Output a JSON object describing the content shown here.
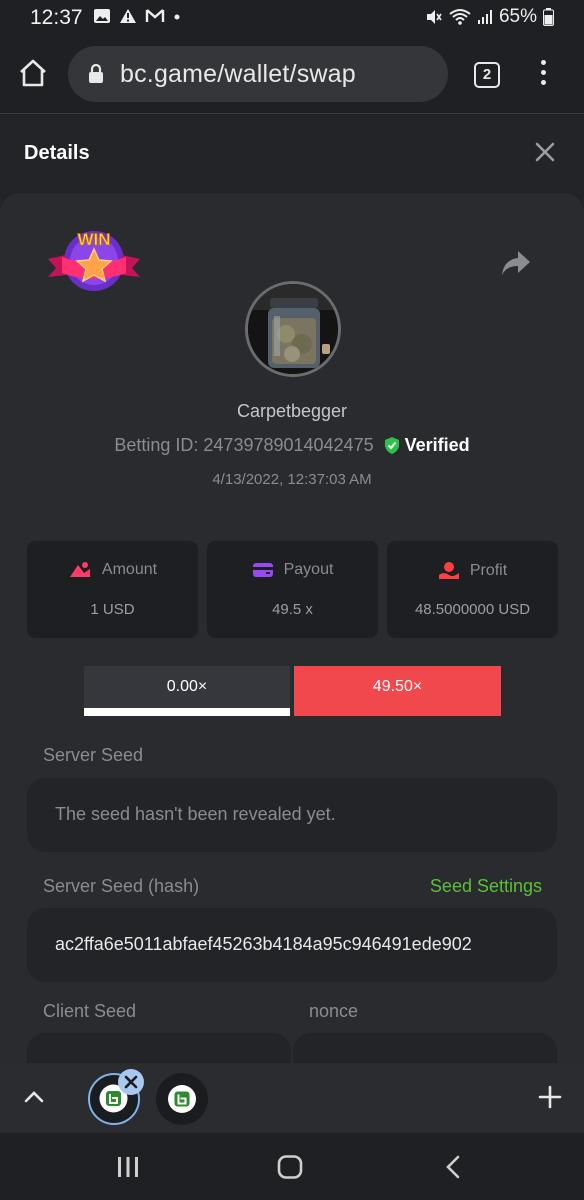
{
  "status_bar": {
    "time": "12:37",
    "battery": "65%",
    "left_icons": [
      "image-icon",
      "warning-icon",
      "gmail-icon",
      "dot-icon"
    ],
    "right_icons": [
      "mute-icon",
      "wifi-icon",
      "signal-icon",
      "battery-icon"
    ]
  },
  "browser": {
    "url": "bc.game/wallet/swap",
    "tab_count": "2"
  },
  "panel": {
    "title": "Details"
  },
  "bet": {
    "badge": "WIN",
    "username": "Carpetbegger",
    "betting_id_label": "Betting ID:",
    "betting_id": "24739789014042475",
    "verified": "Verified",
    "datetime": "4/13/2022, 12:37:03 AM"
  },
  "stats": [
    {
      "label": "Amount",
      "value": "1 USD",
      "icon": "amount-icon"
    },
    {
      "label": "Payout",
      "value": "49.5 x",
      "icon": "wallet-icon"
    },
    {
      "label": "Profit",
      "value": "48.5000000 USD",
      "icon": "profit-icon"
    }
  ],
  "result": {
    "left": "0.00×",
    "right": "49.50×",
    "progress_percent": 100
  },
  "fields": {
    "server_seed_label": "Server Seed",
    "server_seed_value": "The seed hasn't been revealed yet.",
    "server_seed_hash_label": "Server Seed (hash)",
    "seed_settings_link": "Seed Settings",
    "server_seed_hash_value": "ac2ffa6e5011abfaef45263b4184a95c946491ede902",
    "client_seed_label": "Client Seed",
    "nonce_label": "nonce"
  },
  "colors": {
    "accent_green": "#5ac133",
    "bar_red": "#f0484d",
    "verified_green": "#2fbf4a"
  }
}
